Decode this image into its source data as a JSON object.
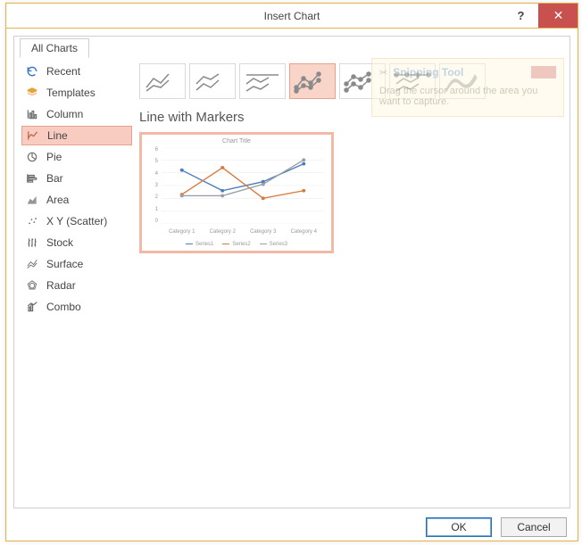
{
  "window": {
    "title": "Insert Chart",
    "help_label": "?",
    "close_label": "✕"
  },
  "tabs": [
    {
      "label": "All Charts"
    }
  ],
  "sidebar": {
    "items": [
      {
        "label": "Recent"
      },
      {
        "label": "Templates"
      },
      {
        "label": "Column"
      },
      {
        "label": "Line"
      },
      {
        "label": "Pie"
      },
      {
        "label": "Bar"
      },
      {
        "label": "Area"
      },
      {
        "label": "X Y (Scatter)"
      },
      {
        "label": "Stock"
      },
      {
        "label": "Surface"
      },
      {
        "label": "Radar"
      },
      {
        "label": "Combo"
      }
    ]
  },
  "content": {
    "subtitle": "Line with Markers"
  },
  "ghost": {
    "title": "Snipping Tool",
    "text": "Drag the cursor around the area you want to capture."
  },
  "footer": {
    "ok": "OK",
    "cancel": "Cancel"
  },
  "chart_data": {
    "type": "line",
    "title": "Chart Title",
    "categories": [
      "Category 1",
      "Category 2",
      "Category 3",
      "Category 4"
    ],
    "series": [
      {
        "name": "Series1",
        "values": [
          4.2,
          2.6,
          3.3,
          4.7
        ],
        "color": "#4a7ebb"
      },
      {
        "name": "Series2",
        "values": [
          2.3,
          4.4,
          2.0,
          2.6
        ],
        "color": "#d87a3e"
      },
      {
        "name": "Series3",
        "values": [
          2.2,
          2.2,
          3.1,
          5.0
        ],
        "color": "#9aa0a6"
      }
    ],
    "ylim": [
      0,
      6
    ],
    "yticks": [
      0,
      1,
      2,
      3,
      4,
      5,
      6
    ],
    "legend": [
      "Series1",
      "Series2",
      "Series3"
    ]
  }
}
